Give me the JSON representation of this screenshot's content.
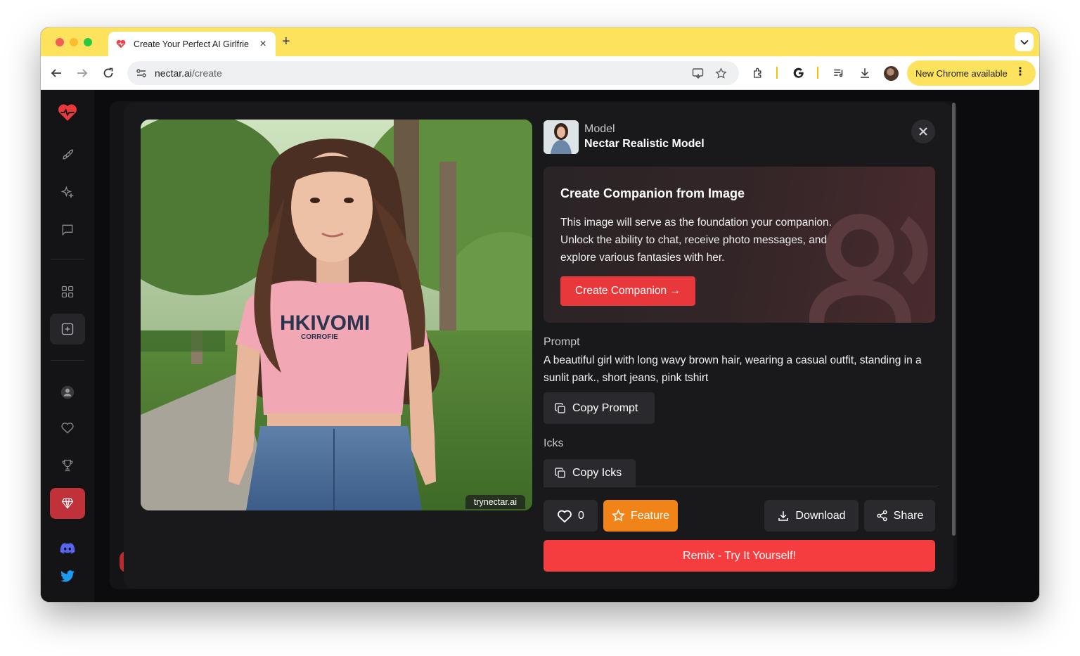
{
  "browser": {
    "tab_title": "Create Your Perfect AI Girlfrie",
    "url_host": "nectar.ai",
    "url_path": "/create",
    "chrome_update_label": "New Chrome available"
  },
  "sidebar": {
    "items": [
      "heartbeat-logo",
      "rocket-icon",
      "sparkles-icon",
      "chat-icon",
      "grid-icon",
      "add-square-icon",
      "user-icon",
      "heart-icon",
      "trophy-icon",
      "diamond-icon",
      "discord-icon",
      "twitter-icon"
    ]
  },
  "modal": {
    "watermark": "trynectar.ai",
    "model_label": "Model",
    "model_name": "Nectar Realistic Model",
    "cta_title": "Create Companion from Image",
    "cta_text": "This image will serve as the foundation your companion. Unlock the ability to chat, receive photo messages, and explore various fantasies with her.",
    "cta_button": "Create Companion →",
    "prompt_label": "Prompt",
    "prompt_text": "A beautiful girl with long wavy brown hair, wearing a casual outfit, standing in a sunlit park., short jeans, pink tshirt",
    "copy_prompt": "Copy Prompt",
    "icks_label": "Icks",
    "copy_icks": "Copy Icks",
    "like_count": "0",
    "feature": "Feature",
    "download": "Download",
    "share": "Share",
    "remix": "Remix - Try It Yourself!",
    "shirt_text": "HKIVOMI",
    "shirt_subtext": "CORROFIE"
  },
  "colors": {
    "accent_red": "#f53d40",
    "feature_orange": "#f08418",
    "chrome_yellow": "#fde25e"
  }
}
